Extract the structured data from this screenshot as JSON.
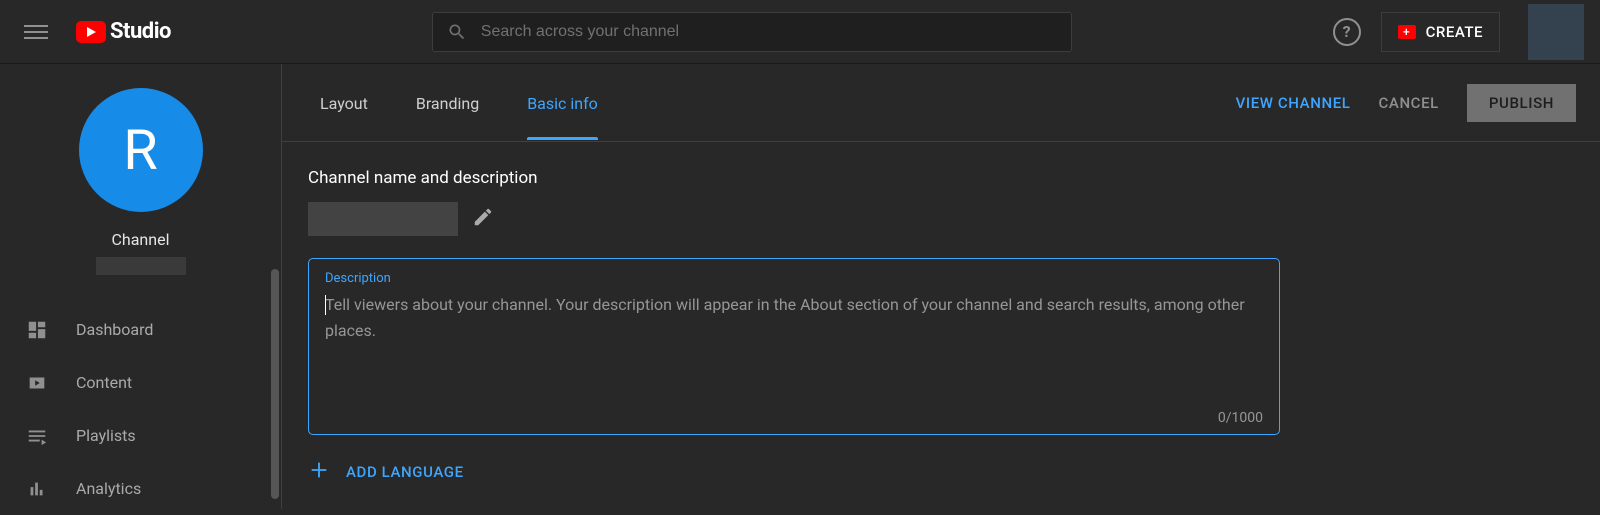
{
  "header": {
    "logo_text": "Studio",
    "search_placeholder": "Search across your channel",
    "help_symbol": "?",
    "create_label": "CREATE"
  },
  "sidebar": {
    "avatar_letter": "R",
    "channel_label": "Channel",
    "items": [
      {
        "label": "Dashboard",
        "icon": "dashboard-icon"
      },
      {
        "label": "Content",
        "icon": "content-icon"
      },
      {
        "label": "Playlists",
        "icon": "playlists-icon"
      },
      {
        "label": "Analytics",
        "icon": "analytics-icon"
      }
    ]
  },
  "tabs": {
    "items": [
      "Layout",
      "Branding",
      "Basic info"
    ],
    "active_index": 2
  },
  "actions": {
    "view_channel": "VIEW CHANNEL",
    "cancel": "CANCEL",
    "publish": "PUBLISH"
  },
  "basic_info": {
    "section_title": "Channel name and description",
    "description_label": "Description",
    "description_placeholder": "Tell viewers about your channel. Your description will appear in the About section of your channel and search results, among other places.",
    "description_value": "",
    "description_counter": "0/1000",
    "add_language_label": "ADD LANGUAGE"
  }
}
